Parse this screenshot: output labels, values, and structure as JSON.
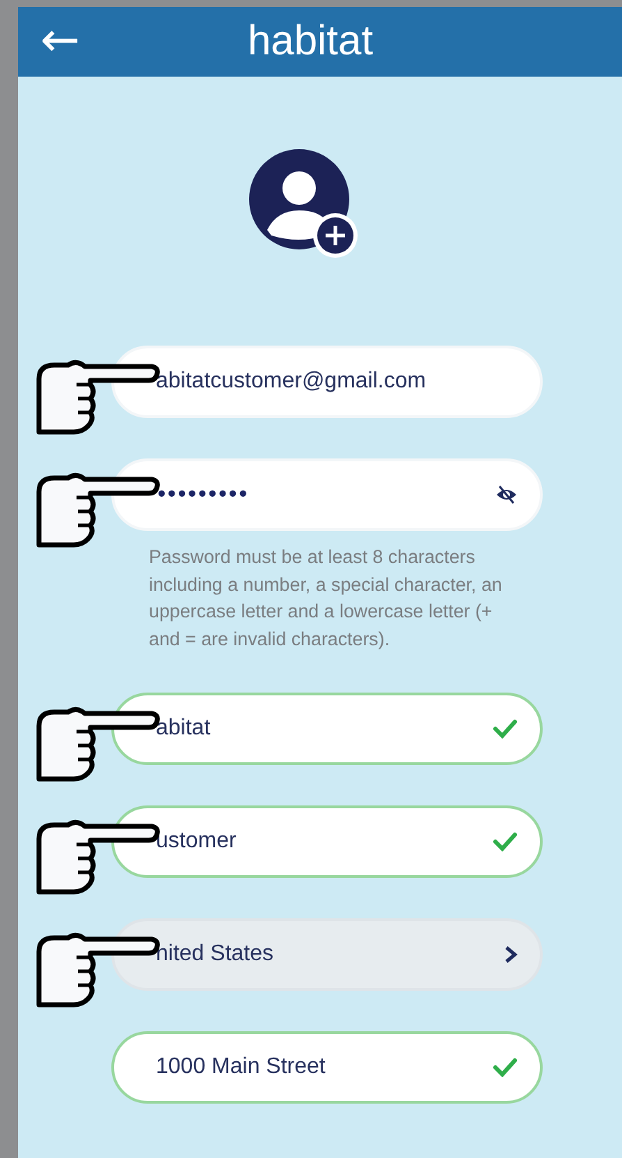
{
  "header": {
    "back_icon": "←",
    "title": "habitat"
  },
  "fields": [
    {
      "kind": "text",
      "value": "abitatcustomer@gmail.com",
      "valid": false,
      "pointed": true
    },
    {
      "kind": "password",
      "value": "•••••••••",
      "valid": false,
      "pointed": true,
      "hint": "Password must be at least 8 characters including a number, a special character, an uppercase letter and a lowercase letter (+ and = are invalid characters)."
    },
    {
      "kind": "text",
      "value": "abitat",
      "valid": true,
      "pointed": true
    },
    {
      "kind": "text",
      "value": "ustomer",
      "valid": true,
      "pointed": true
    },
    {
      "kind": "select",
      "value": "nited States",
      "valid": false,
      "pointed": true
    },
    {
      "kind": "text",
      "value": "1000 Main Street",
      "valid": true,
      "pointed": false
    }
  ]
}
